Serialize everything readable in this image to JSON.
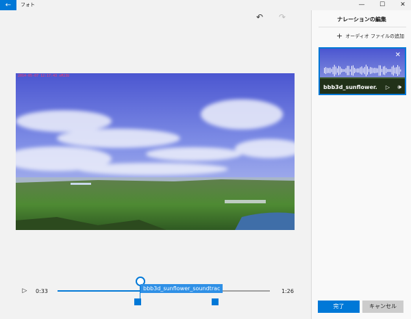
{
  "window": {
    "back_glyph": "←",
    "title": "フォト",
    "controls": {
      "minimize": "—",
      "maximize": "☐",
      "close": "✕"
    }
  },
  "toolbar": {
    "undo_glyph": "↶",
    "redo_glyph": "↷"
  },
  "video": {
    "timestamp": "2014-05-07 12:17:43 xM23U"
  },
  "timeline": {
    "play_glyph": "▷",
    "current_time": "0:33",
    "end_time": "1:26",
    "clip_label": "bbb3d_sunflower_soundtrac",
    "progress": 0.387
  },
  "panel": {
    "title": "ナレーションの編集",
    "add_audio_plus": "+",
    "add_audio_label": "オーディオ ファイルの追加",
    "audio_card": {
      "name": "bbb3d_sunflower...",
      "close_glyph": "✕",
      "play_glyph": "▷",
      "volume_glyph": "🕪"
    },
    "done_label": "完了",
    "cancel_label": "キャンセル"
  },
  "colors": {
    "accent": "#0078d7",
    "clip": "#2f90e6",
    "timestamp": "#ff3b6b"
  }
}
